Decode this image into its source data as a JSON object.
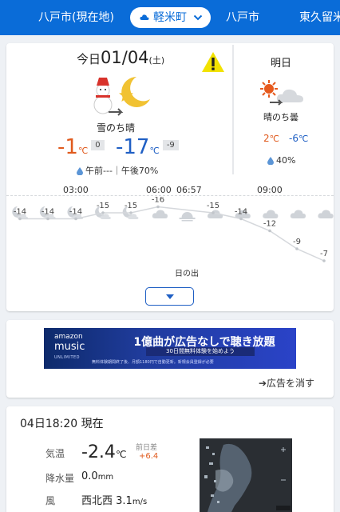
{
  "tabs": [
    {
      "label": "八戸市(現在地)"
    },
    {
      "label": "軽米町",
      "active": true
    },
    {
      "label": "八戸市"
    },
    {
      "label": "東久留米"
    }
  ],
  "today": {
    "prefix": "今日",
    "date": "01/04",
    "weekday": "(土)",
    "weather": "雪のち晴",
    "high": "-1",
    "high_diff": "0",
    "low": "-17",
    "low_diff": "-9",
    "unit": "℃",
    "rain": "午前---｜午後70%"
  },
  "tomorrow": {
    "title": "明日",
    "weather": "晴のち曇",
    "high": "2",
    "low": "-6",
    "unit": "℃",
    "rain": "40%"
  },
  "timeline": {
    "times": [
      "03:00",
      "06:00",
      "06:57",
      "09:00"
    ],
    "temps": [
      -14,
      -14,
      -14,
      -15,
      -15,
      -16,
      -15,
      -14,
      -12,
      -9,
      -7
    ],
    "temp_labels": [
      "-14",
      "-14",
      "-14",
      "-15",
      "-15",
      "-16",
      "-15",
      "-14",
      "-12",
      "-9",
      "-7"
    ],
    "icons": [
      "moon-cloud-icon",
      "moon-cloud-icon",
      "moon-cloud-icon",
      "moon-cloud-icon",
      "moon-cloud-icon",
      "cloud-icon",
      "sunrise-icon",
      "cloud-icon",
      "cloud-icon",
      "cloud-icon",
      "cloud-icon",
      "cloud-icon",
      "cloud-icon"
    ],
    "sunrise_label": "日の出"
  },
  "ad": {
    "brand_top": "amazon",
    "brand_main": "music",
    "brand_sub": "UNLIMITED",
    "headline": "1億曲が広告なしで聴き放題",
    "cta": "30日間無料体験を始めよう",
    "fine": "無料体験期間終了後、月額1180円で自動更新。新規会員登録が必要",
    "remove_label": "➔広告を消す"
  },
  "current": {
    "title": "04日18:20 現在",
    "temp_label": "気温",
    "temp_value": "-2.4",
    "temp_unit": "℃",
    "prev_label": "前日差",
    "prev_value": "+6.4",
    "precip_label": "降水量",
    "precip_value": "0.0",
    "precip_unit": "mm",
    "wind_label": "風",
    "wind_dir": "西北西",
    "wind_value": "3.1",
    "wind_unit": "m/s"
  },
  "colors": {
    "brand_blue": "#0a6cd8",
    "high_orange": "#e05a1d",
    "low_blue": "#1f5fc4"
  }
}
